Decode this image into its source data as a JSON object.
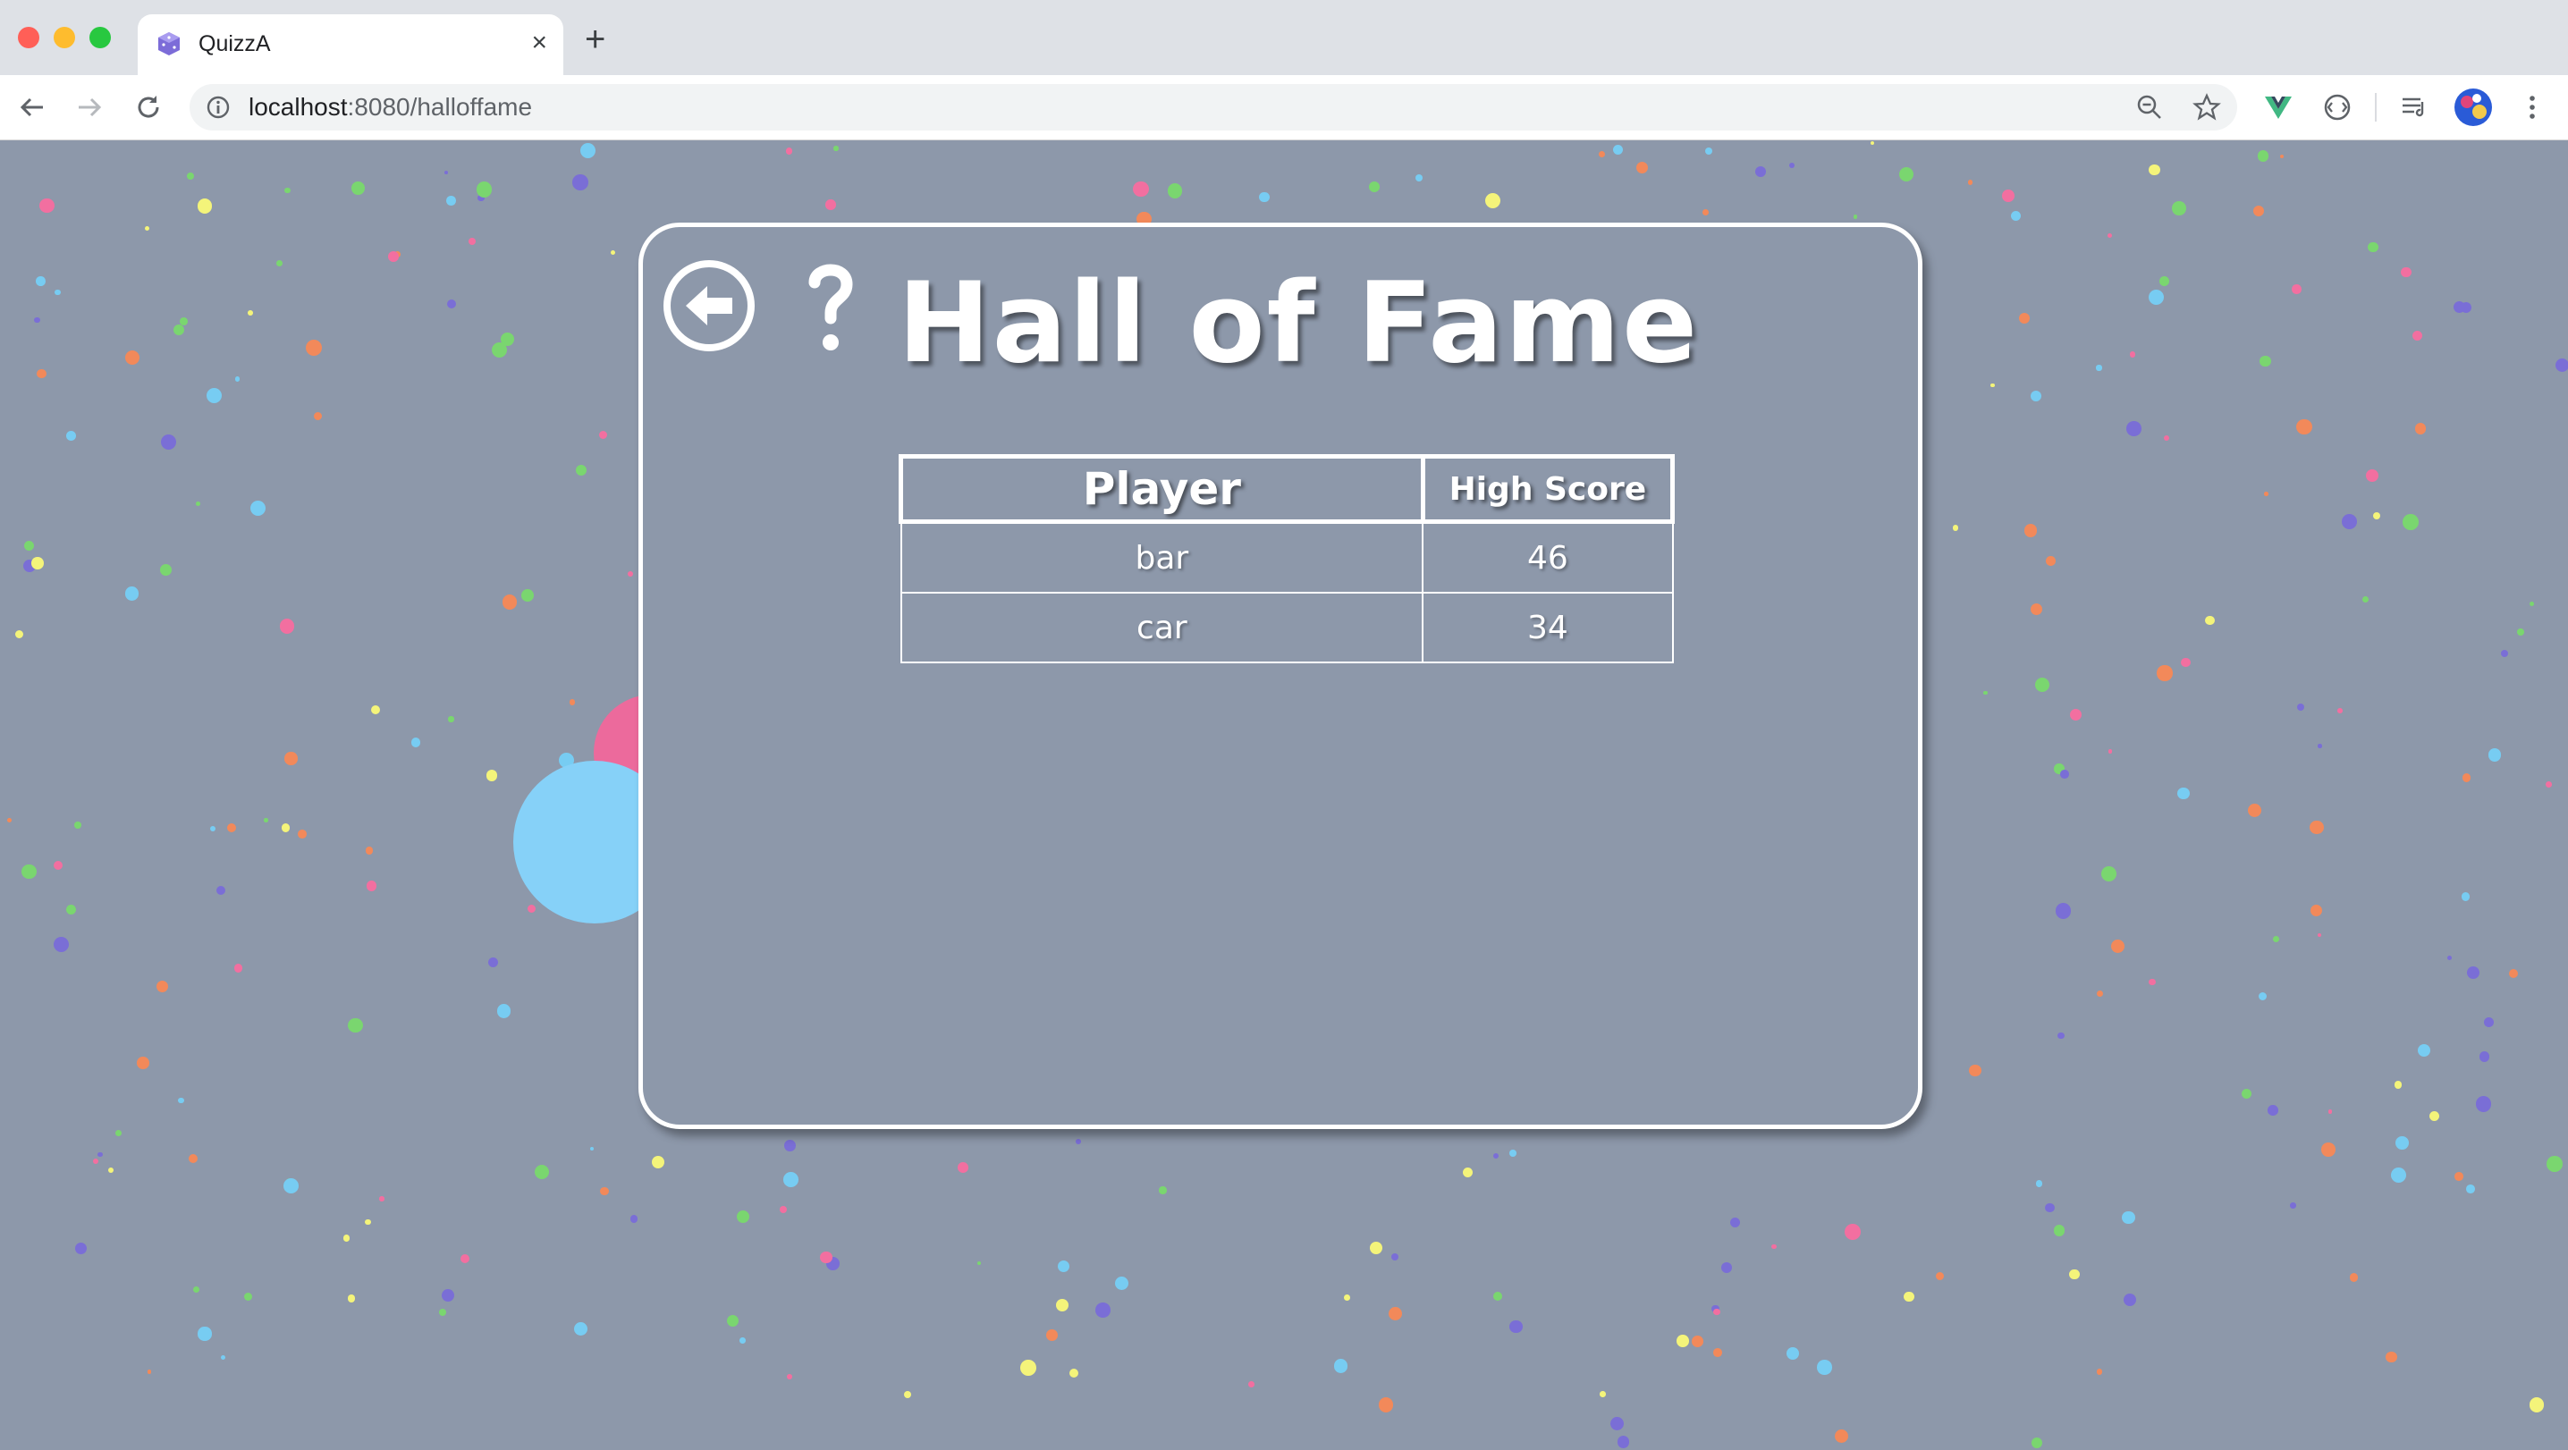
{
  "browser": {
    "tab_title": "QuizzA",
    "tab_close": "×",
    "new_tab": "+",
    "url_host": "localhost",
    "url_path": ":8080/halloffame",
    "icons": [
      "back-arrow-icon",
      "forward-arrow-icon",
      "reload-icon",
      "info-icon",
      "zoom-out-icon",
      "star-icon",
      "vue-devtools-icon",
      "extension-icon",
      "reading-list-icon",
      "profile-avatar-icon",
      "more-menu-icon"
    ]
  },
  "page": {
    "title": "Hall of Fame",
    "help_label": "?",
    "back_icon": "back-arrow-circle-icon",
    "table": {
      "headers": [
        "Player",
        "High Score"
      ],
      "rows": [
        {
          "player": "bar",
          "score": "46"
        },
        {
          "player": "car",
          "score": "34"
        }
      ]
    }
  },
  "colors": {
    "background": "#8d98aa",
    "card_border": "#ffffff",
    "confetti": [
      "#f4f47a",
      "#77ccf2",
      "#f2895a",
      "#f26fa0",
      "#7a6ed6",
      "#7ad66f"
    ]
  }
}
